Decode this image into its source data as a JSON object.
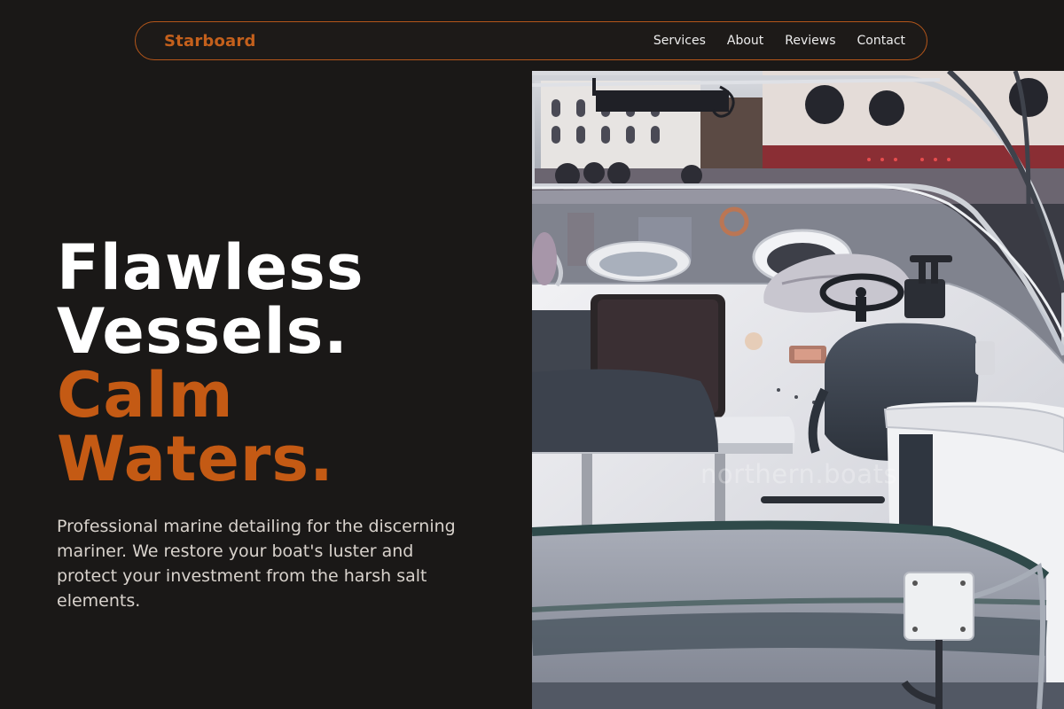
{
  "nav": {
    "brand": "Starboard",
    "links": [
      "Services",
      "About",
      "Reviews",
      "Contact"
    ]
  },
  "hero": {
    "title_line1": "Flawless",
    "title_line2": "Vessels.",
    "title_accent_line1": "Calm",
    "title_accent_line2": "Waters.",
    "description": "Professional marine detailing for the discerning mariner. We restore your boat's luster and protect your investment from the harsh salt elements.",
    "image_watermark": "northern.boats"
  },
  "colors": {
    "background": "#1a1817",
    "accent": "#c45a14",
    "text": "#ffffff",
    "muted_text": "#d8d2cc"
  }
}
